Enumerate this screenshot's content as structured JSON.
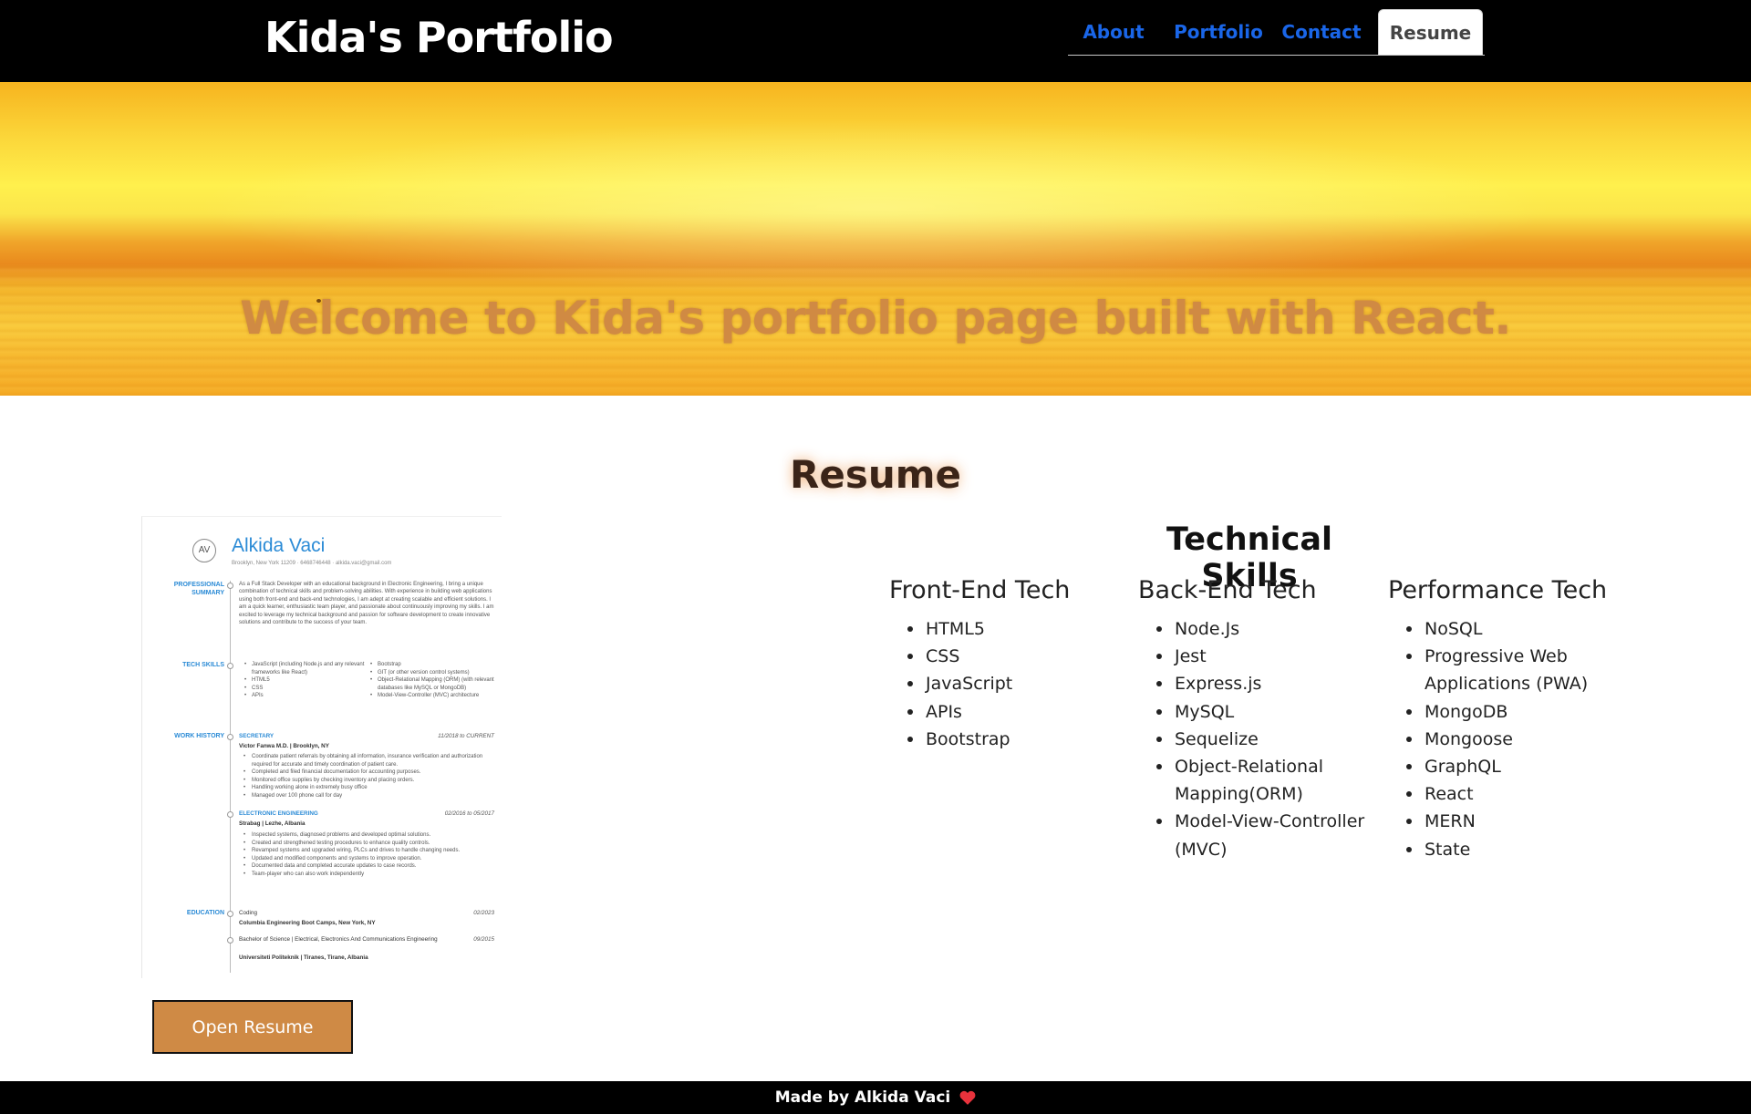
{
  "header": {
    "brand": "Kida's Portfolio",
    "nav": [
      {
        "label": "About"
      },
      {
        "label": "Portfolio"
      },
      {
        "label": "Contact"
      },
      {
        "label": "Resume",
        "active": true
      }
    ]
  },
  "hero": {
    "title": "Welcome to Kida's portfolio page built with React."
  },
  "resume": {
    "section_title": "Resume",
    "open_button": "Open Resume",
    "document": {
      "initials": "AV",
      "name": "Alkida Vaci",
      "contact": "Brooklyn, New York 11209  ·  6468746448  ·  alkida.vaci@gmail.com",
      "sections": {
        "summary_label": "PROFESSIONAL SUMMARY",
        "summary_text": "As a Full Stack Developer with an educational background in Electronic Engineering, I bring a unique combination of technical skills and problem-solving abilities. With experience in building web applications using both front-end and back-end technologies, I am adept at creating scalable and efficient solutions. I am a quick learner, enthusiastic team player, and passionate about continuously improving my skills. I am excited to leverage my technical background and passion for software development to create innovative solutions and contribute to the success of your team.",
        "skills_label": "TECH SKILLS",
        "skills_left": [
          "JavaScript (including Node.js and any relevant frameworks like React)",
          "HTML5",
          "CSS",
          "APIs"
        ],
        "skills_right": [
          "Bootstrap",
          "GIT (or other version control systems)",
          "Object-Relational Mapping (ORM) (with relevant databases like MySQL or MongoDB)",
          "Model-View-Controller (MVC) architecture"
        ],
        "work_label": "WORK HISTORY",
        "job1_title": "SECRETARY",
        "job1_dates": "11/2018 to CURRENT",
        "job1_company": "Victor Fanwa M.D. | Brooklyn, NY",
        "job1_bullets": [
          "Coordinate patient referrals by obtaining all information, insurance verification and authorization required for accurate and timely coordination of patient care.",
          "Completed and filed financial documentation for accounting purposes.",
          "Monitored office supplies by checking inventory and placing orders.",
          "Handling working alone in extremely busy office",
          "Managed over 100 phone call for day"
        ],
        "job2_title": "ELECTRONIC ENGINEERING",
        "job2_dates": "02/2016 to 05/2017",
        "job2_company": "Strabag | Lezhe, Albania",
        "job2_bullets": [
          "Inspected systems, diagnosed problems and developed optimal solutions.",
          "Created and strengthened testing procedures to enhance quality controls.",
          "Revamped systems and upgraded wiring, PLCs and drives to handle changing needs.",
          "Updated and modified components and systems to improve operation.",
          "Documented data and completed accurate updates to case records.",
          "Team-player who can also work independently"
        ],
        "education_label": "EDUCATION",
        "edu1_title": "Coding",
        "edu1_date": "02/2023",
        "edu1_school": "Columbia Engineering Boot Camps, New York, NY",
        "edu2_title": "Bachelor of Science | Electrical, Electronics And Communications Engineering",
        "edu2_date": "09/2015",
        "edu2_school": "Universiteti Politeknik | Tiranes, Tirane, Albania"
      }
    }
  },
  "skills": {
    "title": "Technical Skills",
    "columns": [
      {
        "heading": "Front-End Tech",
        "items": [
          "HTML5",
          "CSS",
          "JavaScript",
          "APIs",
          "Bootstrap"
        ]
      },
      {
        "heading": "Back-End Tech",
        "items": [
          "Node.Js",
          "Jest",
          "Express.js",
          "MySQL",
          "Sequelize",
          "Object-Relational Mapping(ORM)",
          "Model-View-Controller (MVC)"
        ]
      },
      {
        "heading": "Performance Tech",
        "items": [
          "NoSQL",
          "Progressive Web Applications (PWA)",
          "MongoDB",
          "Mongoose",
          "GraphQL",
          "React",
          "MERN",
          "State"
        ]
      }
    ]
  },
  "footer": {
    "text": "Made by Alkida Vaci",
    "icon": "heart-icon",
    "heart_color": "#e8323c"
  },
  "colors": {
    "nav_link": "#1a66e8",
    "accent_button": "#cf8a45",
    "hero_title": "#d08a43",
    "resume_blue": "#2b8bd6"
  }
}
